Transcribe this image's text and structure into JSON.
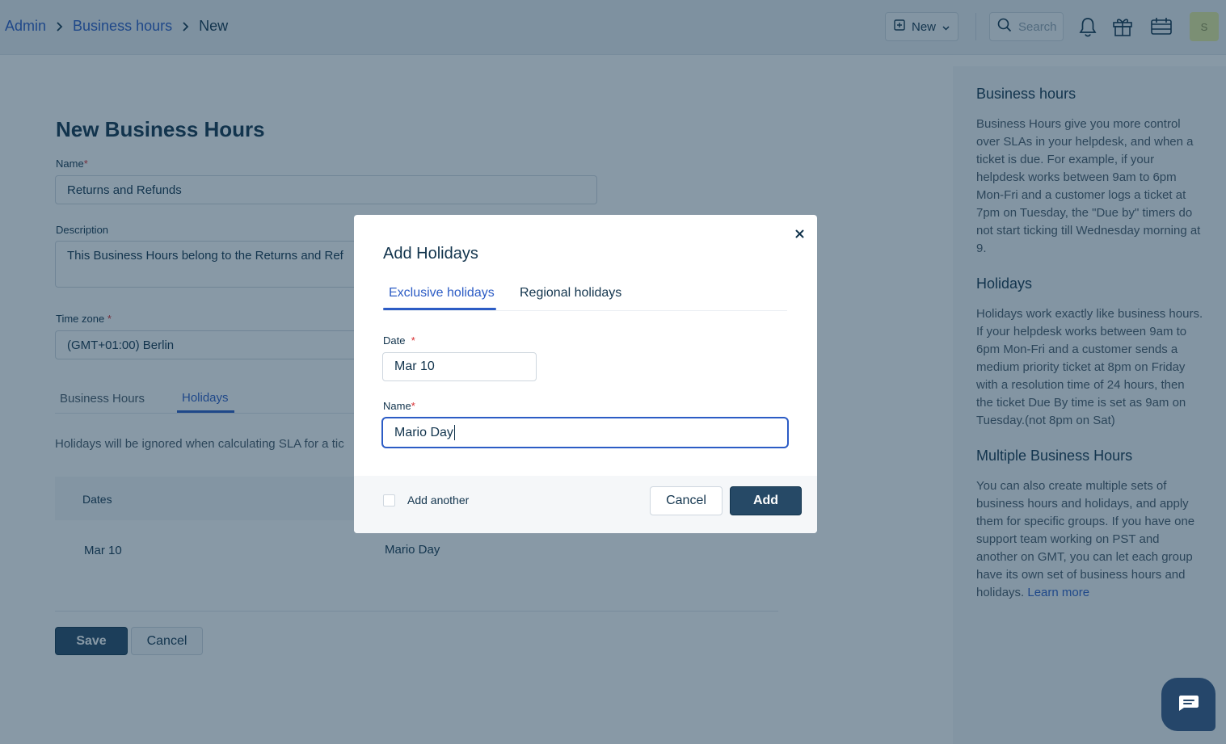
{
  "topbar": {
    "breadcrumb": [
      "Admin",
      "Business hours",
      "New"
    ],
    "new_label": "New",
    "search_placeholder": "Search",
    "avatar_initial": "S"
  },
  "form": {
    "title": "New Business Hours",
    "name_label": "Name",
    "name_value": "Returns and Refunds",
    "description_label": "Description",
    "description_value": "This Business Hours belong to the Returns and Ref",
    "timezone_label": "Time zone",
    "timezone_value": "(GMT+01:00) Berlin",
    "tabs": [
      "Business Hours",
      "Holidays"
    ],
    "active_tab": "Holidays",
    "sla_note": "Holidays will be ignored when calculating SLA for a tic",
    "table": {
      "headers": [
        "Dates"
      ],
      "rows": [
        {
          "date": "Mar 10",
          "name": "Mario Day"
        }
      ]
    },
    "save_label": "Save",
    "cancel_label": "Cancel"
  },
  "help": {
    "sections": [
      {
        "title": "Business hours",
        "text": "Business Hours give you more control over SLAs in your helpdesk, and when a ticket is due. For example, if your helpdesk works between 9am to 6pm Mon-Fri and a customer logs a ticket at 7pm on Tuesday, the \"Due by\" timers do not start ticking till Wednesday morning at 9."
      },
      {
        "title": "Holidays",
        "text": "Holidays work exactly like business hours. If your helpdesk works between 9am to 6pm Mon-Fri and a customer sends a medium priority ticket at 8pm on Friday with a resolution time of 24 hours, then the ticket Due By time is set as 9am on Tuesday.(not 8pm on Sat)"
      },
      {
        "title": "Multiple Business Hours",
        "text": "You can also create multiple sets of business hours and holidays, and apply them for specific groups. If you have one support team working on PST and another on GMT, you can let each group have its own set of business hours and holidays.",
        "link": "Learn more"
      }
    ]
  },
  "modal": {
    "title": "Add Holidays",
    "tabs": [
      "Exclusive holidays",
      "Regional holidays"
    ],
    "active_tab": "Exclusive holidays",
    "date_label": "Date",
    "date_value": "Mar 10",
    "name_label": "Name",
    "name_value": "Mario Day",
    "add_another_label": "Add another",
    "add_another_checked": false,
    "cancel_label": "Cancel",
    "add_label": "Add"
  },
  "colors": {
    "accent": "#2c5cc5",
    "primary_button": "#264966",
    "text": "#12344d",
    "required": "#d72d30"
  }
}
